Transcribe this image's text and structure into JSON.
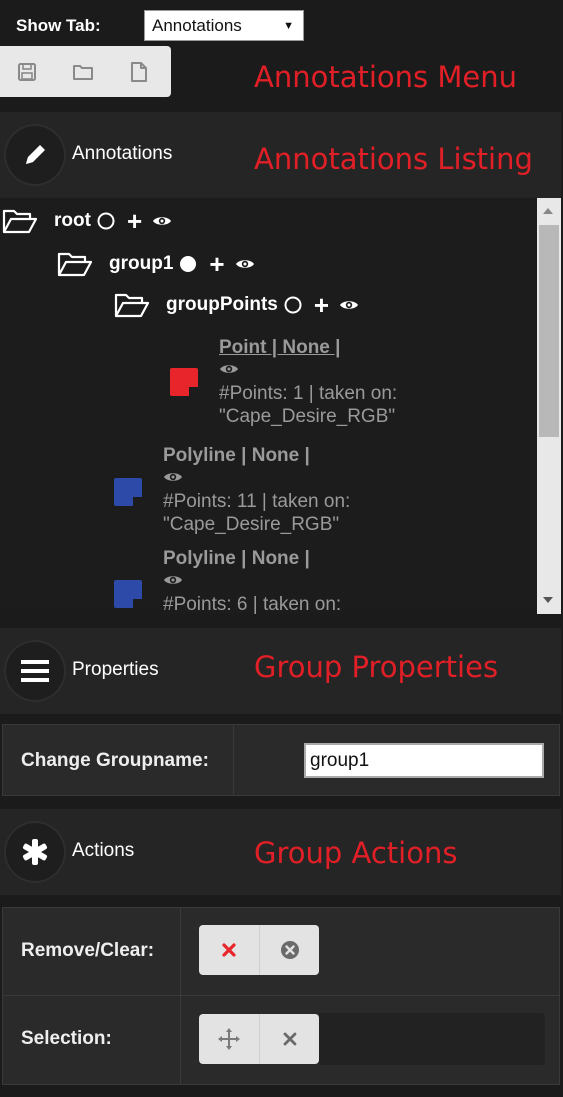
{
  "header": {
    "show_tab_label": "Show Tab:",
    "tab_selected": "Annotations"
  },
  "menu": {
    "icons": [
      "save-icon",
      "folder-icon",
      "document-icon"
    ]
  },
  "callouts": {
    "menu": "Annotations Menu",
    "listing": "Annotations Listing",
    "properties": "Group Properties",
    "actions": "Group Actions"
  },
  "sections": {
    "annotations": "Annotations",
    "properties": "Properties",
    "actions": "Actions"
  },
  "tree": {
    "root": "root",
    "group1": "group1",
    "groupPoints": "groupPoints",
    "leaves": [
      {
        "title": "Point | None |",
        "line1": "#Points: 1 | taken on:",
        "line2": "\"Cape_Desire_RGB\"",
        "color": "#e8252a"
      },
      {
        "title": "Polyline | None |",
        "line1": "#Points: 11 | taken on:",
        "line2": "\"Cape_Desire_RGB\"",
        "color": "#2e4aa8"
      },
      {
        "title": "Polyline | None |",
        "line1": "#Points: 6 | taken on:",
        "line2": "",
        "color": "#2e4aa8"
      }
    ]
  },
  "properties": {
    "change_groupname_label": "Change Groupname:",
    "groupname_value": "group1"
  },
  "actions": {
    "remove_clear_label": "Remove/Clear:",
    "selection_label": "Selection:"
  },
  "colors": {
    "accent_red": "#e11f26",
    "remove_x": "#e8252a"
  }
}
